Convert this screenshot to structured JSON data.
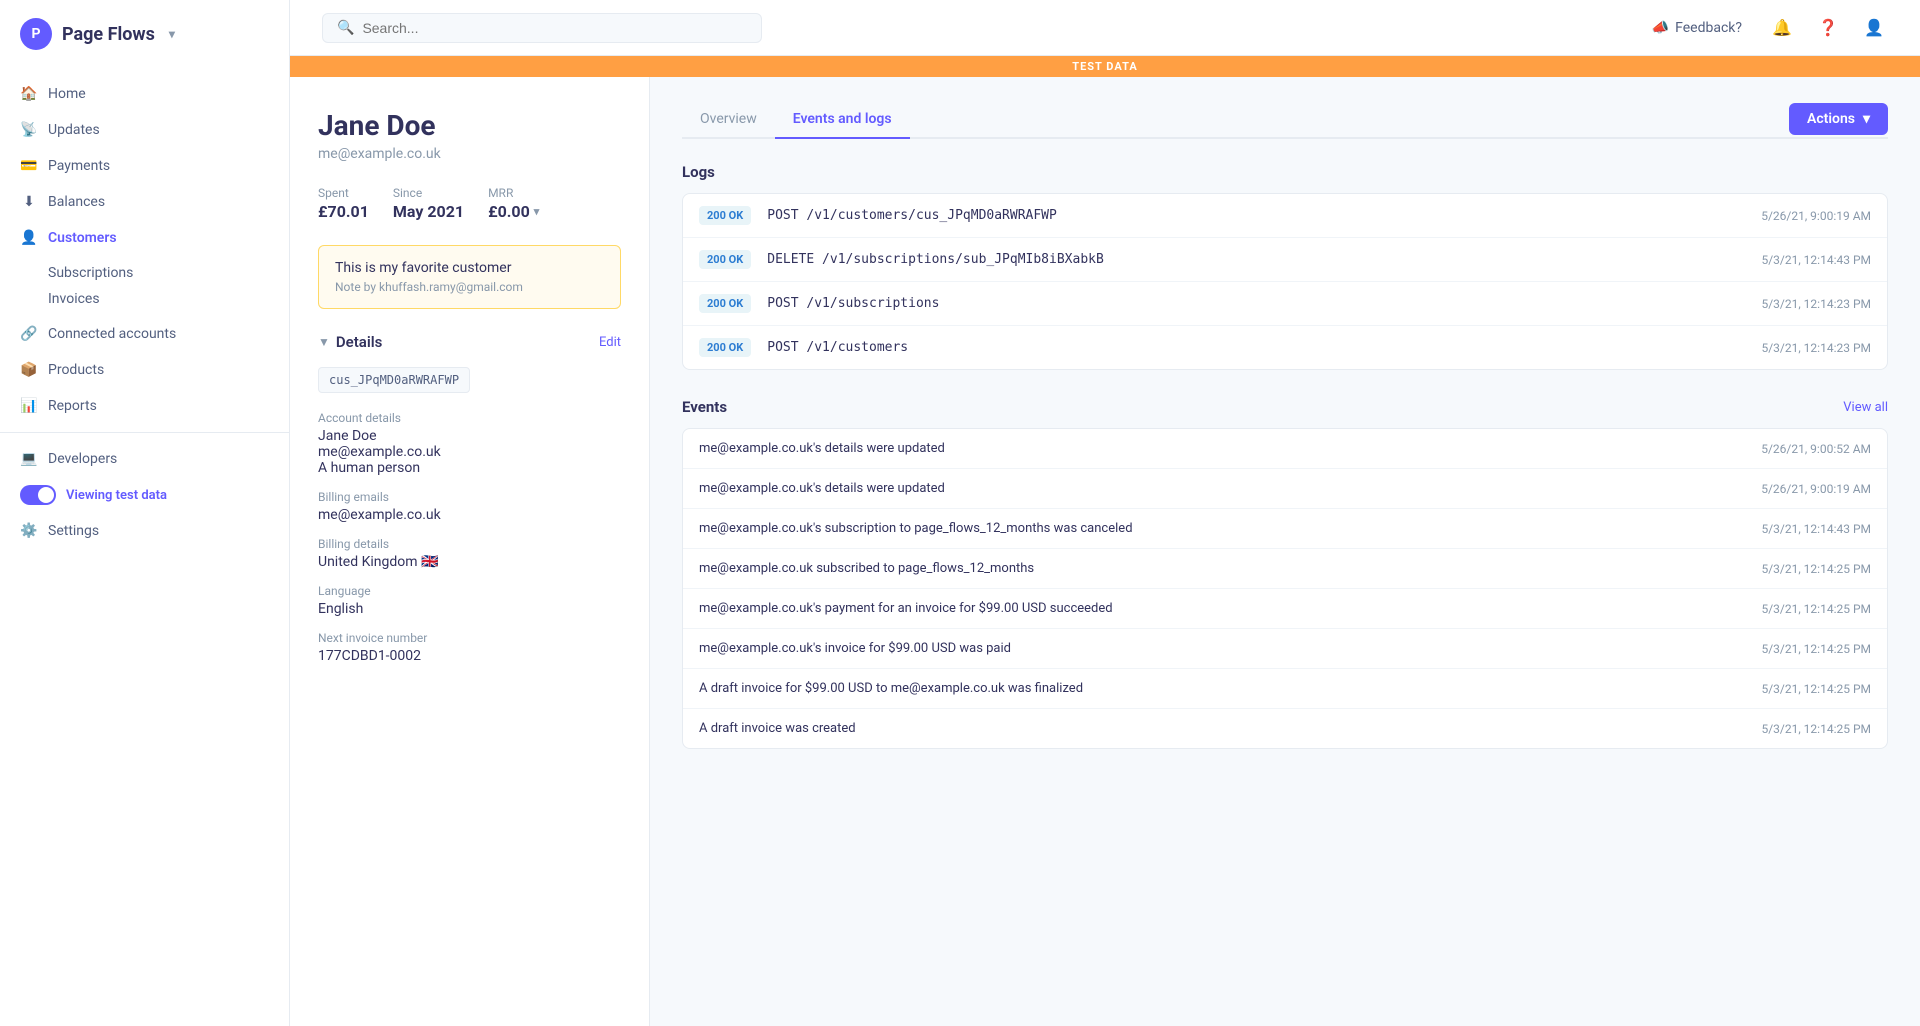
{
  "app": {
    "name": "Page Flows",
    "logo_text": "P"
  },
  "sidebar": {
    "items": [
      {
        "id": "home",
        "label": "Home",
        "icon": "🏠"
      },
      {
        "id": "updates",
        "label": "Updates",
        "icon": "📡"
      },
      {
        "id": "payments",
        "label": "Payments",
        "icon": "💳"
      },
      {
        "id": "balances",
        "label": "Balances",
        "icon": "⬇"
      },
      {
        "id": "customers",
        "label": "Customers",
        "icon": "👤"
      },
      {
        "id": "connected-accounts",
        "label": "Connected accounts",
        "icon": "🔗"
      },
      {
        "id": "products",
        "label": "Products",
        "icon": "📦"
      },
      {
        "id": "reports",
        "label": "Reports",
        "icon": "📊"
      },
      {
        "id": "developers",
        "label": "Developers",
        "icon": "💻"
      },
      {
        "id": "settings",
        "label": "Settings",
        "icon": "⚙️"
      }
    ],
    "sub_items": [
      {
        "id": "subscriptions",
        "label": "Subscriptions"
      },
      {
        "id": "invoices",
        "label": "Invoices"
      }
    ],
    "viewing_test_data": "Viewing test data"
  },
  "topbar": {
    "search_placeholder": "Search...",
    "feedback_label": "Feedback?"
  },
  "test_banner": "TEST DATA",
  "customer": {
    "name": "Jane Doe",
    "email": "me@example.co.uk",
    "stats": {
      "spent_label": "Spent",
      "spent_value": "£70.01",
      "since_label": "Since",
      "since_value": "May 2021",
      "mrr_label": "MRR",
      "mrr_value": "£0.00"
    },
    "note": {
      "text": "This is my favorite customer",
      "by": "Note by khuffash.ramy@gmail.com"
    },
    "details_section": "Details",
    "edit_label": "Edit",
    "customer_id": "cus_JPqMD0aRWRAFWP",
    "account_details_label": "Account details",
    "account_name": "Jane Doe",
    "account_email": "me@example.co.uk",
    "account_description": "A human person",
    "billing_emails_label": "Billing emails",
    "billing_email": "me@example.co.uk",
    "billing_details_label": "Billing details",
    "billing_country": "United Kingdom",
    "language_label": "Language",
    "language": "English",
    "next_invoice_label": "Next invoice number",
    "next_invoice": "177CDBD1-0002"
  },
  "tabs": [
    {
      "id": "overview",
      "label": "Overview"
    },
    {
      "id": "events-logs",
      "label": "Events and logs"
    }
  ],
  "actions_label": "Actions",
  "logs": {
    "section_label": "Logs",
    "items": [
      {
        "status": "200 OK",
        "endpoint": "POST /v1/customers/cus_JPqMD0aRWRAFWP",
        "time": "5/26/21, 9:00:19 AM"
      },
      {
        "status": "200 OK",
        "endpoint": "DELETE /v1/subscriptions/sub_JPqMIb8iBXabkB",
        "time": "5/3/21, 12:14:43 PM"
      },
      {
        "status": "200 OK",
        "endpoint": "POST /v1/subscriptions",
        "time": "5/3/21, 12:14:23 PM"
      },
      {
        "status": "200 OK",
        "endpoint": "POST /v1/customers",
        "time": "5/3/21, 12:14:23 PM"
      }
    ]
  },
  "events": {
    "section_label": "Events",
    "view_all_label": "View all",
    "items": [
      {
        "text": "me@example.co.uk's details were updated",
        "time": "5/26/21, 9:00:52 AM"
      },
      {
        "text": "me@example.co.uk's details were updated",
        "time": "5/26/21, 9:00:19 AM"
      },
      {
        "text": "me@example.co.uk's subscription to page_flows_12_months was canceled",
        "time": "5/3/21, 12:14:43 PM"
      },
      {
        "text": "me@example.co.uk subscribed to page_flows_12_months",
        "time": "5/3/21, 12:14:25 PM"
      },
      {
        "text": "me@example.co.uk's payment for an invoice for $99.00 USD succeeded",
        "time": "5/3/21, 12:14:25 PM"
      },
      {
        "text": "me@example.co.uk's invoice for $99.00 USD was paid",
        "time": "5/3/21, 12:14:25 PM"
      },
      {
        "text": "A draft invoice for $99.00 USD to me@example.co.uk was finalized",
        "time": "5/3/21, 12:14:25 PM"
      },
      {
        "text": "A draft invoice was created",
        "time": "5/3/21, 12:14:25 PM"
      }
    ]
  }
}
